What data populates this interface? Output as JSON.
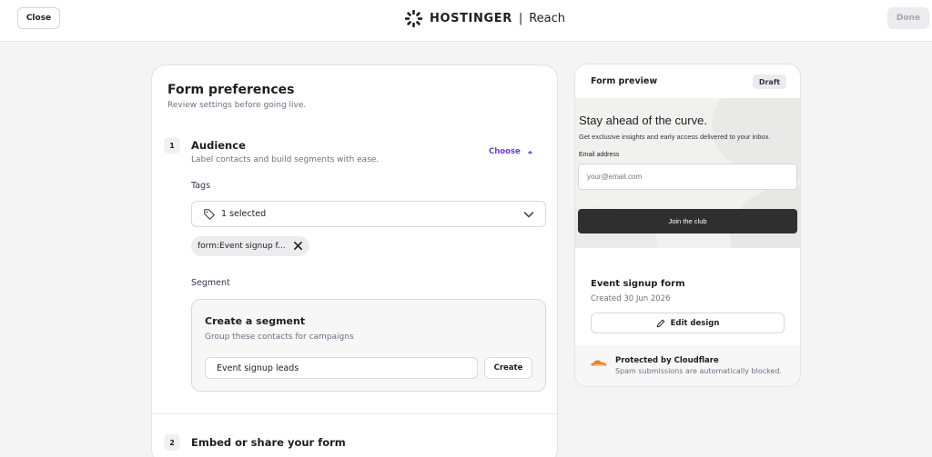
{
  "topbar": {
    "close_label": "Close",
    "brand_name": "HOSTINGER",
    "brand_separator": "|",
    "product_name": "Reach",
    "done_label": "Done"
  },
  "form_preferences": {
    "title": "Form preferences",
    "subtitle": "Review settings before going live.",
    "audience": {
      "number": "1",
      "title": "Audience",
      "subtitle": "Label contacts and build segments with ease.",
      "toggle_label": "Choose",
      "tags": {
        "label": "Tags",
        "selected_text": "1 selected",
        "chips": [
          "form:Event signup f..."
        ]
      },
      "segment": {
        "label": "Segment",
        "box_title": "Create a segment",
        "box_subtitle": "Group these contacts for campaigns",
        "input_value": "Event signup leads",
        "create_label": "Create"
      }
    },
    "embed": {
      "number": "2",
      "title": "Embed or share your form"
    }
  },
  "preview": {
    "title": "Form preview",
    "status_badge": "Draft",
    "headline": "Stay ahead of the curve.",
    "text": "Get exclusive insights and early access delivered to your inbox.",
    "email_label": "Email address",
    "email_placeholder": "your@email.com",
    "button_label": "Join the club",
    "form_name": "Event signup form",
    "created": "Created 30 Jun 2026",
    "edit_label": "Edit design",
    "protection_title": "Protected by Cloudflare",
    "protection_subtitle": "Spam submissions are automatically blocked."
  },
  "colors": {
    "accent": "#673de6",
    "dark_button": "#2f2f2f",
    "cloudflare": "#f38020"
  }
}
